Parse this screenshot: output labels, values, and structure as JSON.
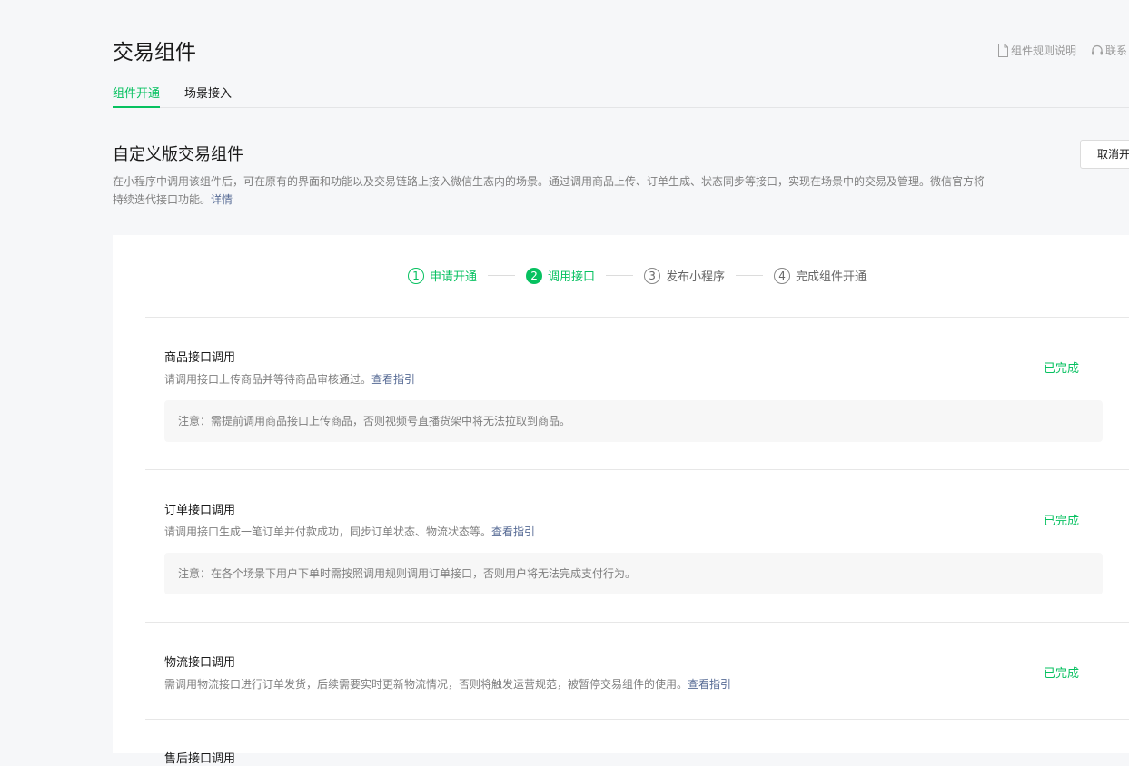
{
  "header": {
    "title": "交易组件",
    "rules_link": "组件规则说明",
    "contact_link": "联系",
    "rules_icon": "document-icon",
    "contact_icon": "headset-icon"
  },
  "tabs": [
    {
      "label": "组件开通",
      "active": true
    },
    {
      "label": "场景接入",
      "active": false
    }
  ],
  "section": {
    "title": "自定义版交易组件",
    "cancel_button": "取消开",
    "description": "在小程序中调用该组件后，可在原有的界面和功能以及交易链路上接入微信生态内的场景。通过调用商品上传、订单生成、状态同步等接口，实现在场景中的交易及管理。微信官方将持续迭代接口功能。",
    "details_link": "详情"
  },
  "steps": [
    {
      "num": "1",
      "label": "申请开通",
      "state": "done"
    },
    {
      "num": "2",
      "label": "调用接口",
      "state": "current"
    },
    {
      "num": "3",
      "label": "发布小程序",
      "state": "pending"
    },
    {
      "num": "4",
      "label": "完成组件开通",
      "state": "pending"
    }
  ],
  "items": [
    {
      "title": "商品接口调用",
      "desc": "请调用接口上传商品并等待商品审核通过。",
      "link": "查看指引",
      "status": "已完成",
      "note": "注意：需提前调用商品接口上传商品，否则视频号直播货架中将无法拉取到商品。"
    },
    {
      "title": "订单接口调用",
      "desc": "请调用接口生成一笔订单并付款成功，同步订单状态、物流状态等。",
      "link": "查看指引",
      "status": "已完成",
      "note": "注意：在各个场景下用户下单时需按照调用规则调用订单接口，否则用户将无法完成支付行为。"
    },
    {
      "title": "物流接口调用",
      "desc": "需调用物流接口进行订单发货，后续需要实时更新物流情况，否则将触发运营规范，被暂停交易组件的使用。",
      "link": "查看指引",
      "status": "已完成"
    },
    {
      "title": "售后接口调用"
    }
  ],
  "colors": {
    "accent": "#07c160",
    "link": "#576b95",
    "background": "#f6f7f9"
  }
}
